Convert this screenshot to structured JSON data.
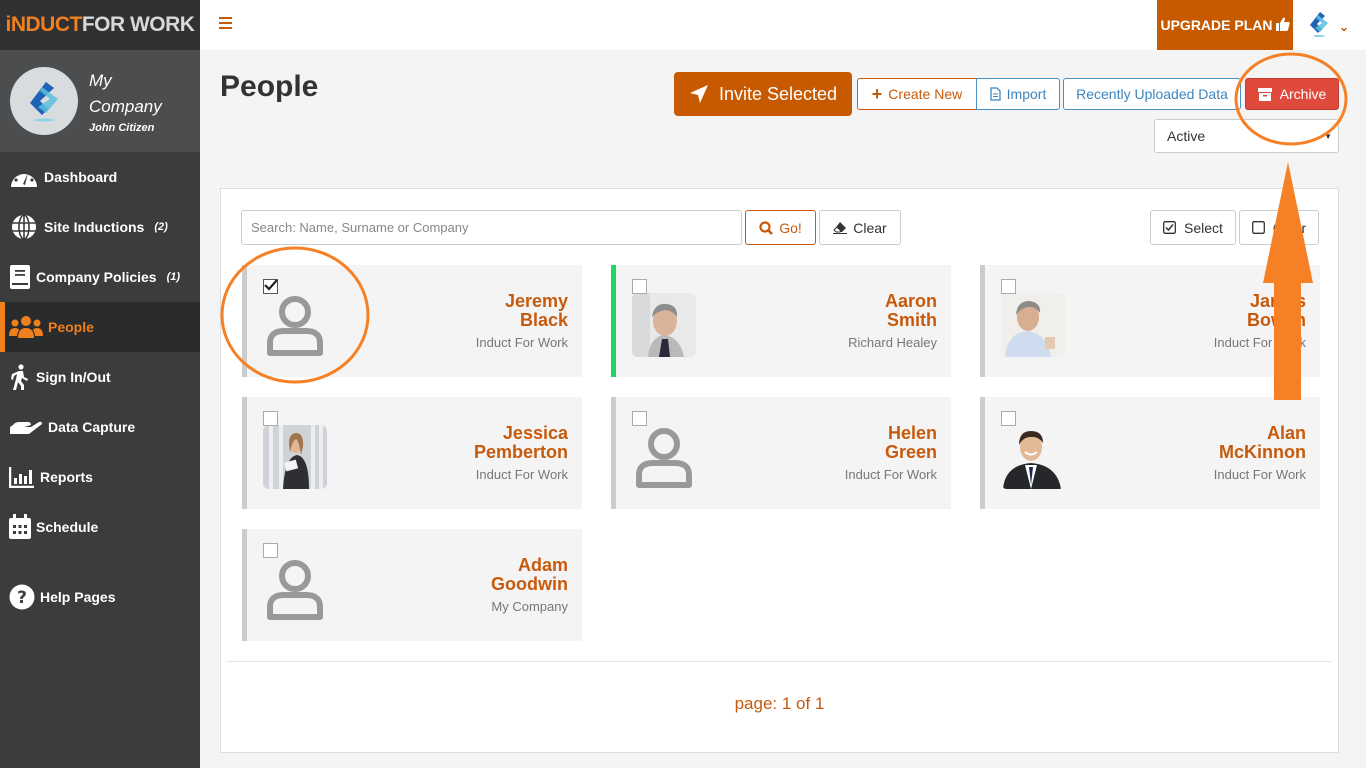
{
  "brand": {
    "logo_part1": "iNDUCT",
    "logo_part2": "FOR WORK"
  },
  "profile": {
    "company": "My Company",
    "user": "John Citizen"
  },
  "sidebar": {
    "items": [
      {
        "label": "Dashboard",
        "icon": "dashboard-icon",
        "count": ""
      },
      {
        "label": "Site Inductions",
        "icon": "globe-icon",
        "count": "(2)"
      },
      {
        "label": "Company Policies",
        "icon": "book-icon",
        "count": "(1)"
      },
      {
        "label": "People",
        "icon": "users-icon",
        "count": "",
        "active": true
      },
      {
        "label": "Sign In/Out",
        "icon": "walking-icon",
        "count": ""
      },
      {
        "label": "Data Capture",
        "icon": "hand-icon",
        "count": ""
      },
      {
        "label": "Reports",
        "icon": "bar-chart-icon",
        "count": ""
      },
      {
        "label": "Schedule",
        "icon": "calendar-icon",
        "count": ""
      },
      {
        "label": "Help Pages",
        "icon": "question-circle-icon",
        "count": ""
      }
    ]
  },
  "topbar": {
    "upgrade_label": "UPGRADE PLAN"
  },
  "header": {
    "title": "People",
    "invite_label": "Invite Selected",
    "create_label": "Create New",
    "import_label": "Import",
    "recent_label": "Recently Uploaded Data",
    "archive_label": "Archive",
    "status_value": "Active"
  },
  "search": {
    "placeholder": "Search: Name, Surname or Company",
    "value": "",
    "go_label": "Go!",
    "clear_label": "Clear",
    "select_label": "Select",
    "clear_selection_label": "Clear"
  },
  "people": [
    {
      "first": "Jeremy",
      "last": "Black",
      "company": "Induct For Work",
      "checked": true,
      "photo": "none"
    },
    {
      "first": "Aaron",
      "last": "Smith",
      "company": "Richard Healey",
      "checked": false,
      "photo": "man-grey-hair",
      "highlight": true
    },
    {
      "first": "James",
      "last": "Bowen",
      "company": "Induct For Work",
      "checked": false,
      "photo": "man-blue-shirt"
    },
    {
      "first": "Jessica",
      "last": "Pemberton",
      "company": "Induct For Work",
      "checked": false,
      "photo": "woman-tablet"
    },
    {
      "first": "Helen",
      "last": "Green",
      "company": "Induct For Work",
      "checked": false,
      "photo": "none"
    },
    {
      "first": "Alan",
      "last": "McKinnon",
      "company": "Induct For Work",
      "checked": false,
      "photo": "man-suit"
    },
    {
      "first": "Adam",
      "last": "Goodwin",
      "company": "My Company",
      "checked": false,
      "photo": "none"
    }
  ],
  "pagination": {
    "text": "page: 1 of 1",
    "current": 1,
    "total": 1
  },
  "colors": {
    "accent": "#c75a0c",
    "sidebar": "#3a3c3d",
    "archive": "#e04a3c",
    "highlight": "#1ed760",
    "annotation": "#f58025"
  }
}
